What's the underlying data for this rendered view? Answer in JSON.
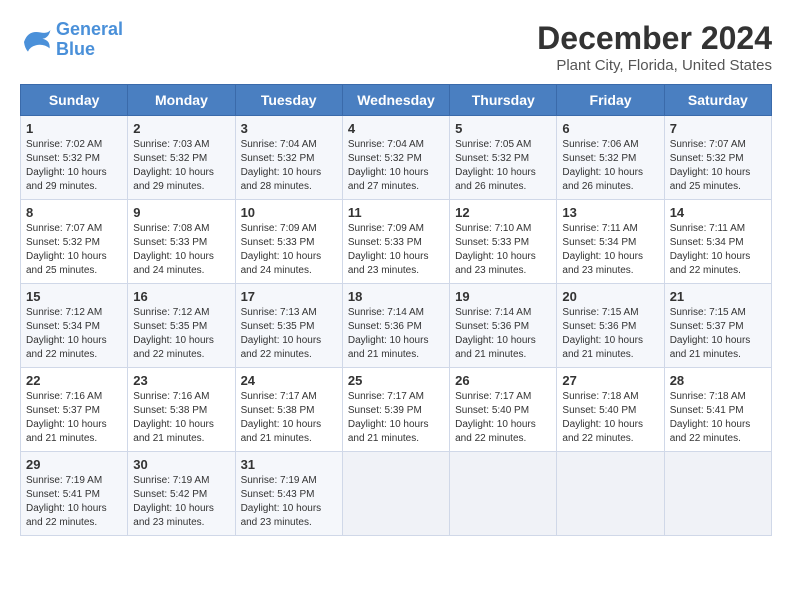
{
  "header": {
    "logo_line1": "General",
    "logo_line2": "Blue",
    "title": "December 2024",
    "subtitle": "Plant City, Florida, United States"
  },
  "calendar": {
    "days_of_week": [
      "Sunday",
      "Monday",
      "Tuesday",
      "Wednesday",
      "Thursday",
      "Friday",
      "Saturday"
    ],
    "weeks": [
      [
        {
          "day": "1",
          "info": "Sunrise: 7:02 AM\nSunset: 5:32 PM\nDaylight: 10 hours and 29 minutes."
        },
        {
          "day": "2",
          "info": "Sunrise: 7:03 AM\nSunset: 5:32 PM\nDaylight: 10 hours and 29 minutes."
        },
        {
          "day": "3",
          "info": "Sunrise: 7:04 AM\nSunset: 5:32 PM\nDaylight: 10 hours and 28 minutes."
        },
        {
          "day": "4",
          "info": "Sunrise: 7:04 AM\nSunset: 5:32 PM\nDaylight: 10 hours and 27 minutes."
        },
        {
          "day": "5",
          "info": "Sunrise: 7:05 AM\nSunset: 5:32 PM\nDaylight: 10 hours and 26 minutes."
        },
        {
          "day": "6",
          "info": "Sunrise: 7:06 AM\nSunset: 5:32 PM\nDaylight: 10 hours and 26 minutes."
        },
        {
          "day": "7",
          "info": "Sunrise: 7:07 AM\nSunset: 5:32 PM\nDaylight: 10 hours and 25 minutes."
        }
      ],
      [
        {
          "day": "8",
          "info": "Sunrise: 7:07 AM\nSunset: 5:32 PM\nDaylight: 10 hours and 25 minutes."
        },
        {
          "day": "9",
          "info": "Sunrise: 7:08 AM\nSunset: 5:33 PM\nDaylight: 10 hours and 24 minutes."
        },
        {
          "day": "10",
          "info": "Sunrise: 7:09 AM\nSunset: 5:33 PM\nDaylight: 10 hours and 24 minutes."
        },
        {
          "day": "11",
          "info": "Sunrise: 7:09 AM\nSunset: 5:33 PM\nDaylight: 10 hours and 23 minutes."
        },
        {
          "day": "12",
          "info": "Sunrise: 7:10 AM\nSunset: 5:33 PM\nDaylight: 10 hours and 23 minutes."
        },
        {
          "day": "13",
          "info": "Sunrise: 7:11 AM\nSunset: 5:34 PM\nDaylight: 10 hours and 23 minutes."
        },
        {
          "day": "14",
          "info": "Sunrise: 7:11 AM\nSunset: 5:34 PM\nDaylight: 10 hours and 22 minutes."
        }
      ],
      [
        {
          "day": "15",
          "info": "Sunrise: 7:12 AM\nSunset: 5:34 PM\nDaylight: 10 hours and 22 minutes."
        },
        {
          "day": "16",
          "info": "Sunrise: 7:12 AM\nSunset: 5:35 PM\nDaylight: 10 hours and 22 minutes."
        },
        {
          "day": "17",
          "info": "Sunrise: 7:13 AM\nSunset: 5:35 PM\nDaylight: 10 hours and 22 minutes."
        },
        {
          "day": "18",
          "info": "Sunrise: 7:14 AM\nSunset: 5:36 PM\nDaylight: 10 hours and 21 minutes."
        },
        {
          "day": "19",
          "info": "Sunrise: 7:14 AM\nSunset: 5:36 PM\nDaylight: 10 hours and 21 minutes."
        },
        {
          "day": "20",
          "info": "Sunrise: 7:15 AM\nSunset: 5:36 PM\nDaylight: 10 hours and 21 minutes."
        },
        {
          "day": "21",
          "info": "Sunrise: 7:15 AM\nSunset: 5:37 PM\nDaylight: 10 hours and 21 minutes."
        }
      ],
      [
        {
          "day": "22",
          "info": "Sunrise: 7:16 AM\nSunset: 5:37 PM\nDaylight: 10 hours and 21 minutes."
        },
        {
          "day": "23",
          "info": "Sunrise: 7:16 AM\nSunset: 5:38 PM\nDaylight: 10 hours and 21 minutes."
        },
        {
          "day": "24",
          "info": "Sunrise: 7:17 AM\nSunset: 5:38 PM\nDaylight: 10 hours and 21 minutes."
        },
        {
          "day": "25",
          "info": "Sunrise: 7:17 AM\nSunset: 5:39 PM\nDaylight: 10 hours and 21 minutes."
        },
        {
          "day": "26",
          "info": "Sunrise: 7:17 AM\nSunset: 5:40 PM\nDaylight: 10 hours and 22 minutes."
        },
        {
          "day": "27",
          "info": "Sunrise: 7:18 AM\nSunset: 5:40 PM\nDaylight: 10 hours and 22 minutes."
        },
        {
          "day": "28",
          "info": "Sunrise: 7:18 AM\nSunset: 5:41 PM\nDaylight: 10 hours and 22 minutes."
        }
      ],
      [
        {
          "day": "29",
          "info": "Sunrise: 7:19 AM\nSunset: 5:41 PM\nDaylight: 10 hours and 22 minutes."
        },
        {
          "day": "30",
          "info": "Sunrise: 7:19 AM\nSunset: 5:42 PM\nDaylight: 10 hours and 23 minutes."
        },
        {
          "day": "31",
          "info": "Sunrise: 7:19 AM\nSunset: 5:43 PM\nDaylight: 10 hours and 23 minutes."
        },
        {
          "day": "",
          "info": ""
        },
        {
          "day": "",
          "info": ""
        },
        {
          "day": "",
          "info": ""
        },
        {
          "day": "",
          "info": ""
        }
      ]
    ]
  }
}
